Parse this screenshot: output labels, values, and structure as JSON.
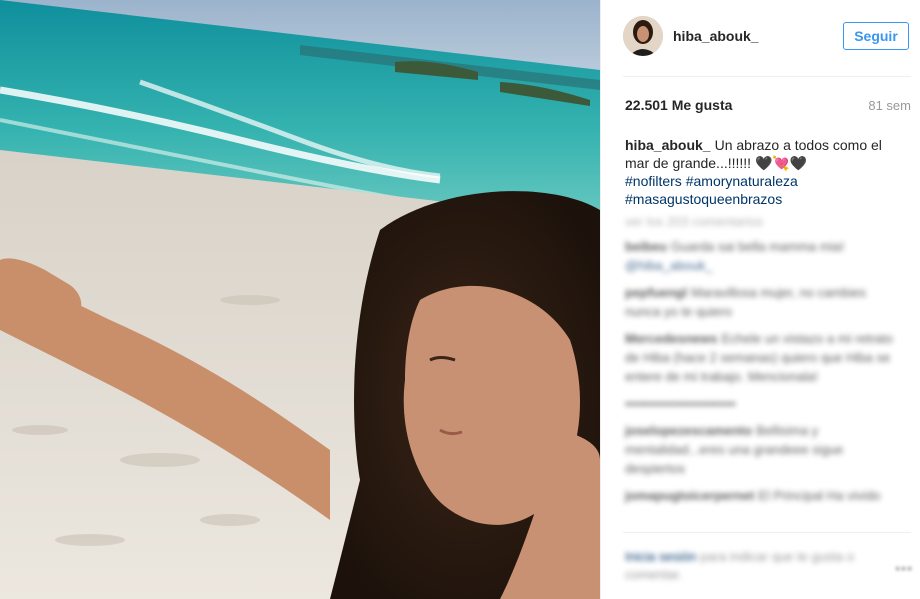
{
  "post": {
    "username": "hiba_abouk_",
    "follow_label": "Seguir",
    "likes": "22.501 Me gusta",
    "age": "81 sem",
    "caption_text": "Un abrazo a todos como el mar de grande...!!!!!! 🖤💘🖤",
    "hashtags": [
      "#nofilters",
      "#amorynaturaleza",
      "#masagustoqueenbrazos"
    ]
  },
  "comments": {
    "view_all": "ver los 203 comentarios",
    "items": [
      {
        "author": "beibeu",
        "text": "Guarda sai bella mamma mia!",
        "mention": "@hiba_abouk_"
      },
      {
        "author": "pepfuengl",
        "text": "Maravillosa mujer, no cambies nunca yo te quiero"
      },
      {
        "author": "Mercedesnews",
        "text": "Echele un vistazo a mi retrato de Hiba (hace 2 semanas) quiero que Hiba se entere de mi trabajo. Mencionala!"
      },
      {
        "author": "",
        "text": "▪▪▪▪▪▪▪▪▪▪▪▪▪▪▪▪▪▪▪▪▪▪▪▪"
      },
      {
        "author": "joselopezescamento",
        "text": "Bellisima y mentalidad...eres una grandeee sigue despiertos"
      },
      {
        "author": "jomapugtoicerpernet",
        "text": "El Principal Ha vivido"
      }
    ]
  },
  "footer": {
    "login_link": "Inicia sesión",
    "rest": "para indicar que te gusta o comentar.",
    "more": "•••"
  },
  "colors": {
    "accent": "#3897f0",
    "link": "#003569",
    "muted": "#999999"
  }
}
